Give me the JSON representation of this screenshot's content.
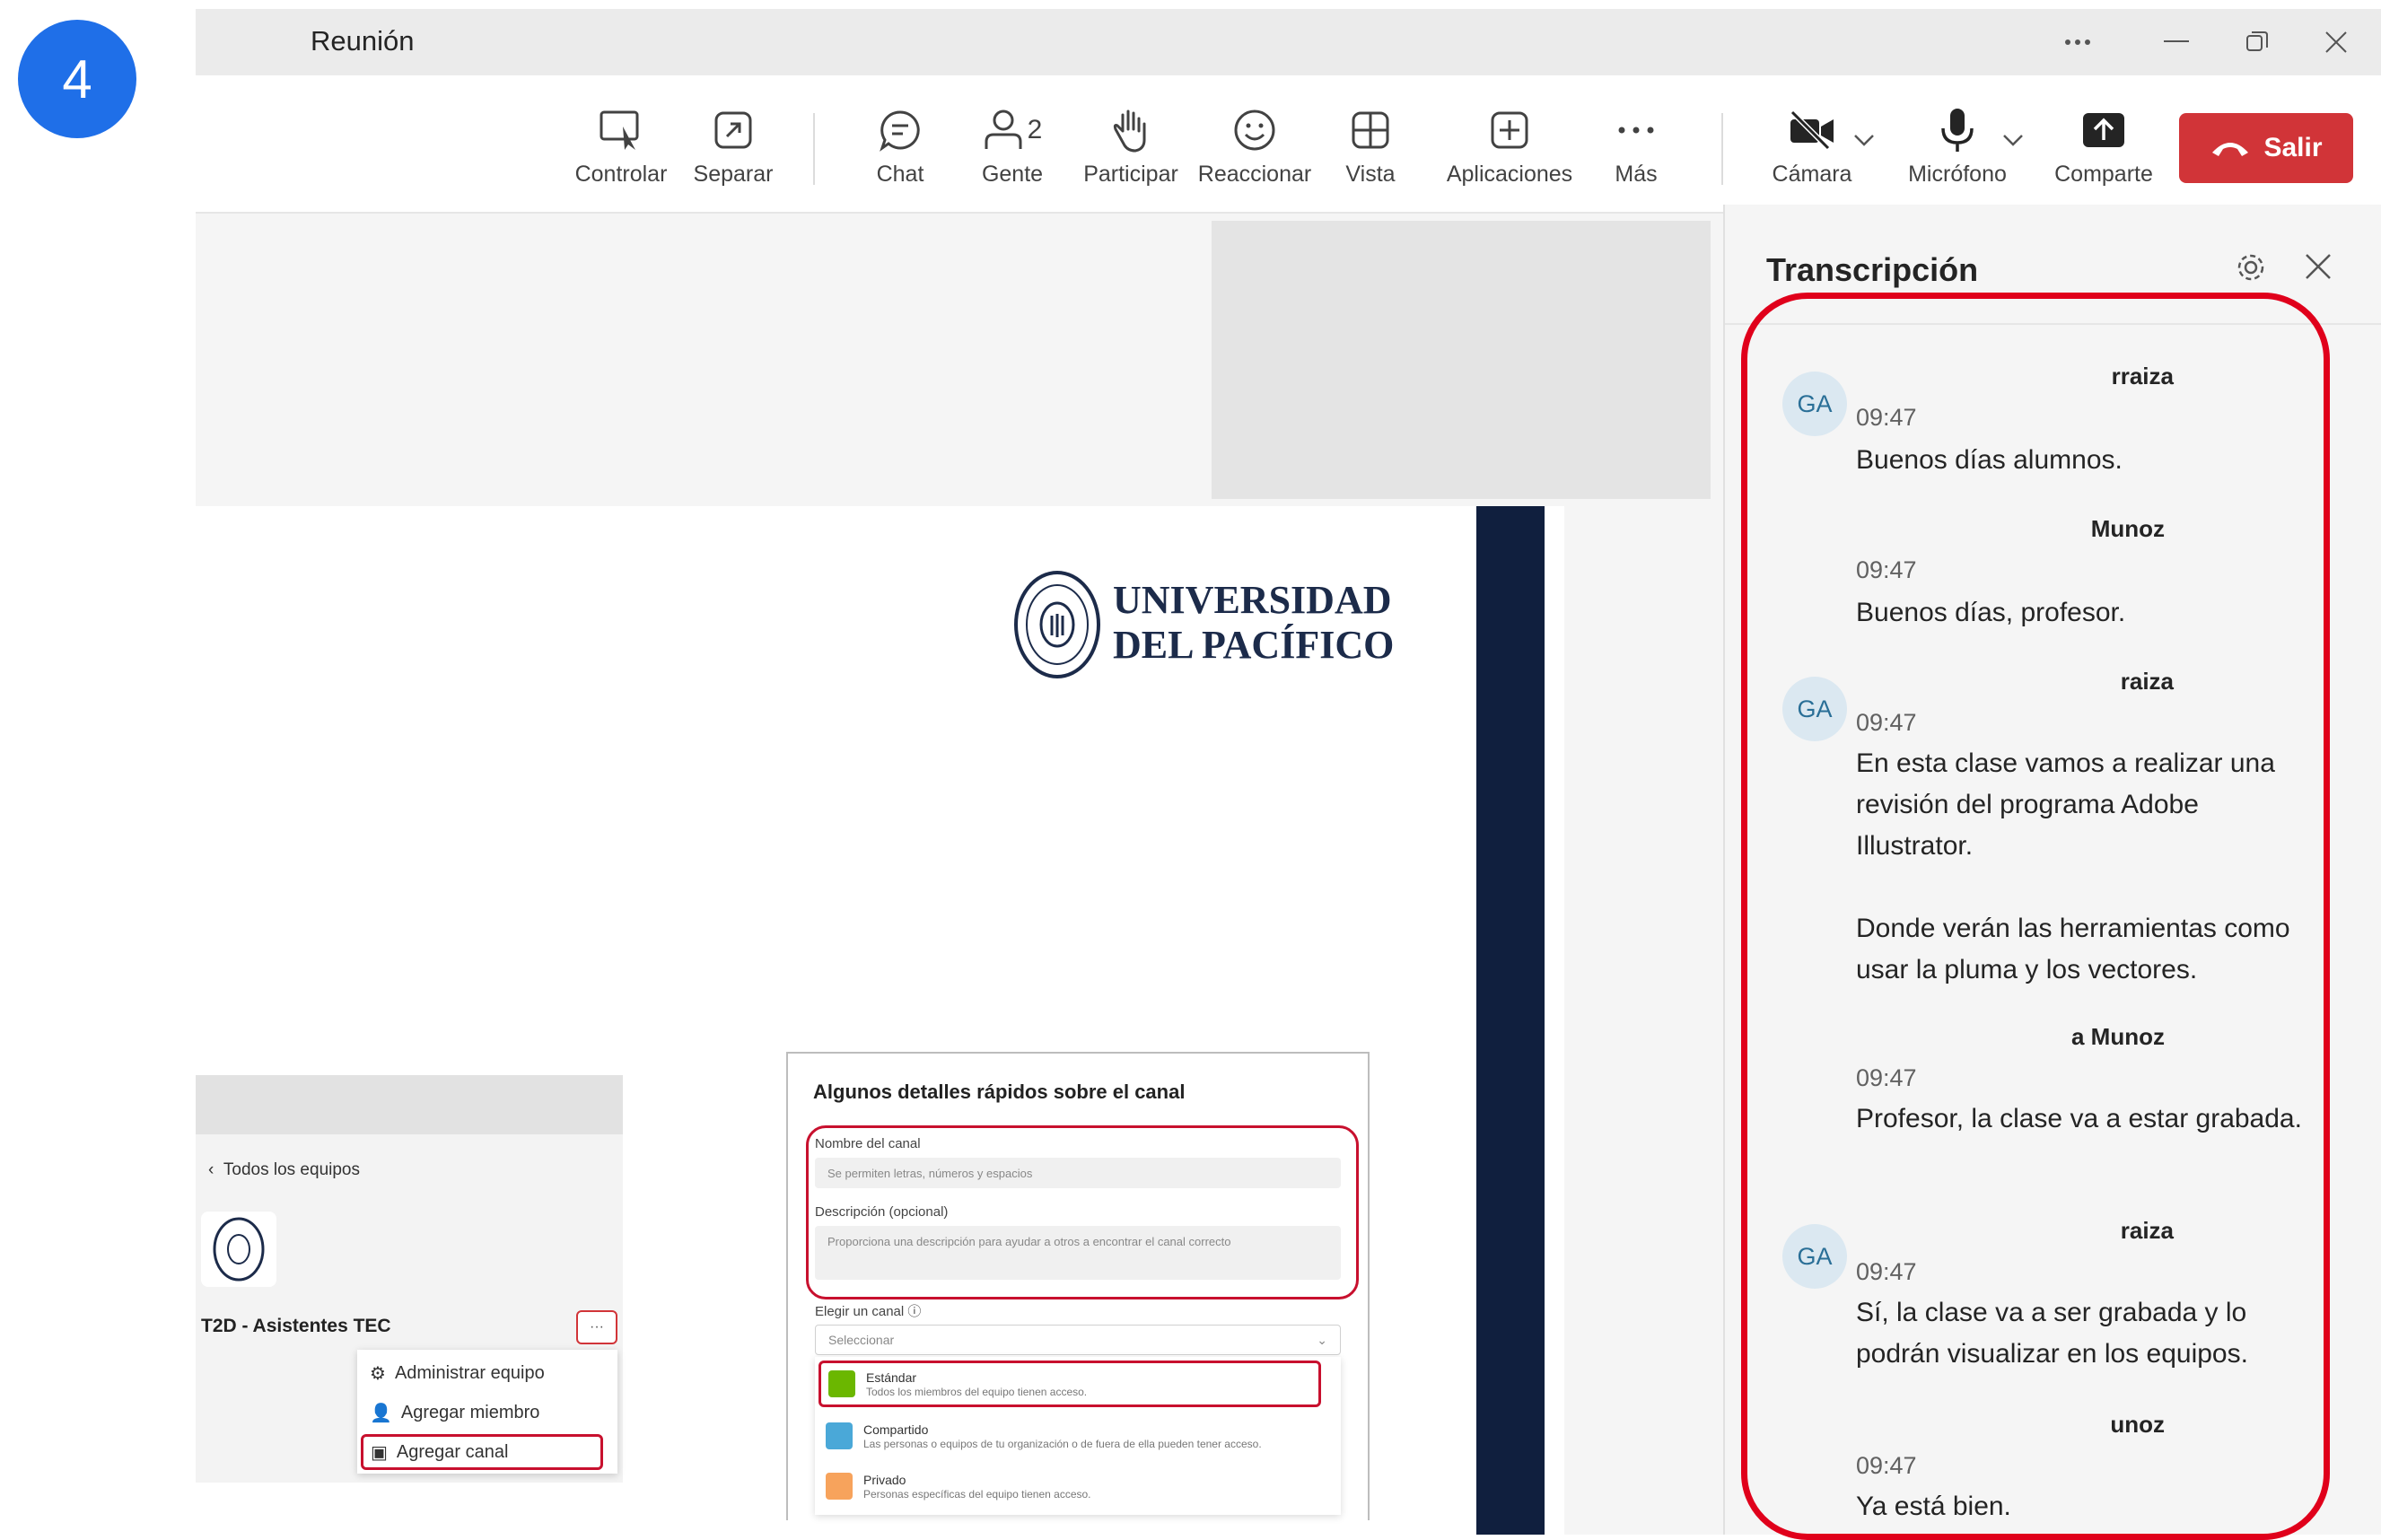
{
  "step_number": "4",
  "window": {
    "title": "Reunión",
    "controls": [
      "more-icon",
      "minimize-icon",
      "restore-icon",
      "close-icon"
    ]
  },
  "toolbar": {
    "items": [
      {
        "label": "Controlar",
        "icon": "take-control-icon"
      },
      {
        "label": "Separar",
        "icon": "pop-out-icon"
      },
      {
        "label": "Chat",
        "icon": "chat-icon"
      },
      {
        "label": "Gente",
        "icon": "people-icon",
        "badge": "2"
      },
      {
        "label": "Participar",
        "icon": "raise-hand-icon"
      },
      {
        "label": "Reaccionar",
        "icon": "react-icon"
      },
      {
        "label": "Vista",
        "icon": "view-icon"
      },
      {
        "label": "Aplicaciones",
        "icon": "apps-icon"
      },
      {
        "label": "Más",
        "icon": "more-icon"
      }
    ],
    "media": [
      {
        "label": "Cámara",
        "icon": "camera-off-icon"
      },
      {
        "label": "Micrófono",
        "icon": "microphone-icon"
      },
      {
        "label": "Comparte",
        "icon": "share-icon"
      }
    ],
    "leave_label": "Salir"
  },
  "slide": {
    "logo_line1": "UNIVERSIDAD",
    "logo_line2": "DEL PACÍFICO",
    "team_view": {
      "back_label": "Todos los equipos",
      "team_name": "T2D - Asistentes TEC",
      "more_label": "···",
      "menu": [
        "Administrar equipo",
        "Agregar miembro",
        "Agregar canal"
      ]
    },
    "channel_dialog": {
      "title": "Algunos detalles rápidos sobre el canal",
      "name_label": "Nombre del canal",
      "name_placeholder": "Se permiten letras, números y espacios",
      "desc_label": "Descripción (opcional)",
      "desc_placeholder": "Proporciona una descripción para ayudar a otros a encontrar el canal correcto",
      "type_label": "Elegir un canal",
      "select_placeholder": "Seleccionar",
      "options": [
        {
          "name": "Estándar",
          "desc": "Todos los miembros del equipo tienen acceso.",
          "color": "#6bb700"
        },
        {
          "name": "Compartido",
          "desc": "Las personas o equipos de tu organización o de fuera de ella pueden tener acceso.",
          "color": "#4aa8d8"
        },
        {
          "name": "Privado",
          "desc": "Personas específicas del equipo tienen acceso.",
          "color": "#f7a35c"
        }
      ]
    }
  },
  "transcript": {
    "title": "Transcripción",
    "entries": [
      {
        "avatar": "GA",
        "speaker": "rraiza",
        "time": "09:47",
        "text": "Buenos días alumnos."
      },
      {
        "avatar": "",
        "speaker": "Munoz",
        "time": "09:47",
        "text": "Buenos días, profesor."
      },
      {
        "avatar": "GA",
        "speaker": "raiza",
        "time": "09:47",
        "text": "En esta clase vamos a realizar una revisión del programa Adobe Illustrator.",
        "text2": "Donde verán las herramientas como usar la pluma y los vectores."
      },
      {
        "avatar": "",
        "speaker": "a Munoz",
        "time": "09:47",
        "text": "Profesor, la clase va a estar grabada."
      },
      {
        "avatar": "GA",
        "speaker": "raiza",
        "time": "09:47",
        "text": "Sí, la clase va a ser grabada y lo podrán visualizar en los equipos."
      },
      {
        "avatar": "",
        "speaker": "unoz",
        "time": "09:47",
        "text": "Ya está bien."
      }
    ]
  },
  "colors": {
    "badge_blue": "#1f6fe8",
    "leave_red": "#d13438",
    "highlight_red": "#e0001b",
    "slide_band": "#101f3e"
  }
}
